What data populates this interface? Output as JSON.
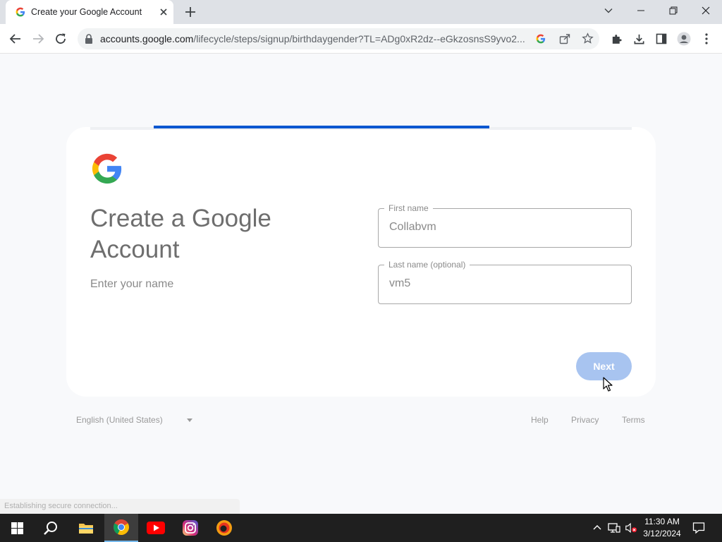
{
  "browser": {
    "tab_title": "Create your Google Account",
    "url_host": "accounts.google.com",
    "url_path": "/lifecycle/steps/signup/birthdaygender?TL=ADg0xR2dz--eGkzosnsS9yvo2..."
  },
  "page": {
    "progress": 0.62,
    "heading": "Create a Google Account",
    "subheading": "Enter your name",
    "first_name_label": "First name",
    "first_name_value": "Collabvm",
    "last_name_label": "Last name (optional)",
    "last_name_value": "vm5",
    "next_label": "Next",
    "language": "English (United States)",
    "footer_help": "Help",
    "footer_privacy": "Privacy",
    "footer_terms": "Terms",
    "status_text": "Establishing secure connection..."
  },
  "taskbar": {
    "time": "11:30 AM",
    "date": "3/12/2024",
    "apps": [
      "start-icon",
      "search-icon",
      "file-explorer-icon",
      "chrome-icon",
      "youtube-icon",
      "instagram-icon",
      "browser-icon"
    ]
  },
  "colors": {
    "accent": "#0b57d0",
    "next_button": "#a8c4f0"
  }
}
